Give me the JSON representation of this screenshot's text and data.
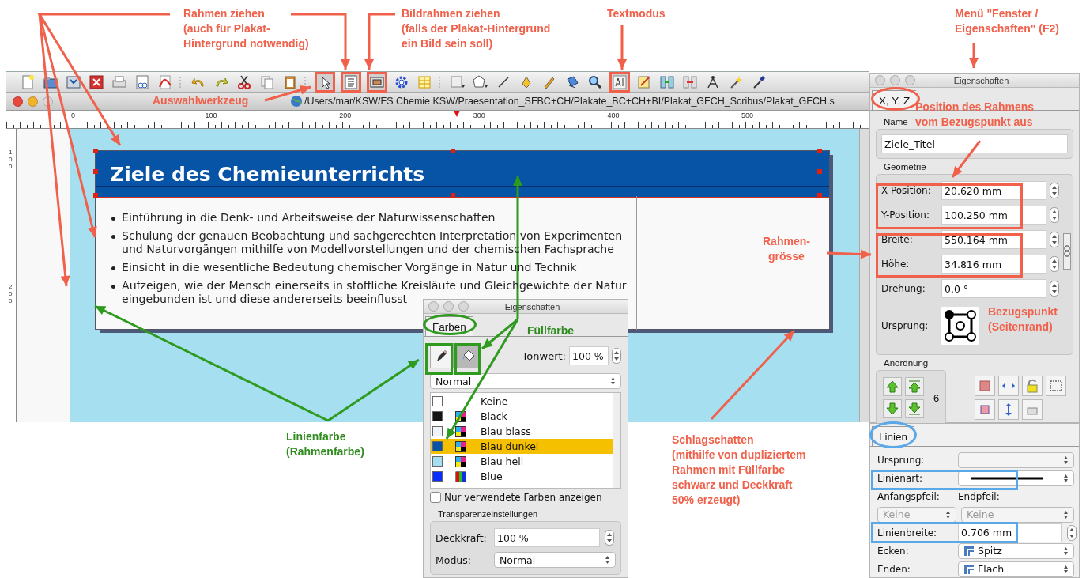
{
  "annotations": [
    {
      "lines": [
        "Rahmen ziehen",
        "(auch für Plakat-",
        "Hintergrund notwendig)"
      ],
      "color": "#f0604a"
    },
    {
      "lines": [
        "Bildrahmen ziehen",
        "(falls der Plakat-Hintergrund",
        "ein Bild sein soll)"
      ],
      "color": "#f0604a"
    },
    {
      "lines": [
        "Textmodus"
      ],
      "color": "#f0604a"
    },
    {
      "lines": [
        "Menü \"Fenster /",
        "Eigenschaften\" (F2)"
      ],
      "color": "#f0604a"
    },
    {
      "lines": [
        "Auswahlwerkzeug"
      ],
      "color": "#f0604a"
    },
    {
      "lines": [
        "Position des Rahmens",
        "vom Bezugspunkt aus"
      ],
      "color": "#f0604a"
    },
    {
      "lines": [
        "Rahmen-",
        "grösse"
      ],
      "color": "#f0604a"
    },
    {
      "lines": [
        "Bezugspunkt",
        "(Seitenrand)"
      ],
      "color": "#f0604a"
    },
    {
      "lines": [
        "Schlagschatten",
        "(mithilfe von dupliziertem",
        "Rahmen mit Füllfarbe",
        "schwarz und Deckkraft",
        "50% erzeugt)"
      ],
      "color": "#f0604a"
    },
    {
      "lines": [
        "Füllfarbe"
      ],
      "color": "#2e8b1e"
    },
    {
      "lines": [
        "Linienfarbe",
        "(Rahmenfarbe)"
      ],
      "color": "#2e8b1e"
    }
  ],
  "document_window": {
    "path": "/Users/mar/KSW/FS Chemie KSW/Praesentation_SFBC+CH/Plakate_BC+CH+BI/Plakat_GFCH_Scribus/Plakat_GFCH.s",
    "ruler": {
      "horizontal": [
        "0",
        "100",
        "200",
        "300",
        "400",
        "500"
      ],
      "vertical": [
        "100",
        "200"
      ]
    },
    "poster": {
      "title": "Ziele des Chemieunterrichts",
      "bullets": [
        "Einführung in die Denk- und Arbeitsweise der Naturwissenschaften",
        "Schulung der genauen Beobachtung und sachgerechten Interpretation von Experimenten und Naturvorgängen mithilfe von Modellvorstellungen und der chemischen Fachsprache",
        "Einsicht in die wesentliche Bedeutung chemischer Vorgänge in Natur und Technik",
        "Aufzeigen, wie der Mensch einerseits in stoffliche Kreisläufe und Gleichgewichte der Natur eingebunden ist und diese andererseits beeinflusst"
      ]
    }
  },
  "properties_panel": {
    "title": "Eigenschaften",
    "tab": "X, Y, Z",
    "name_label": "Name",
    "name_value": "Ziele_Titel",
    "geometry_label": "Geometrie",
    "fields": [
      {
        "label": "X-Position:",
        "value": "20.620 mm"
      },
      {
        "label": "Y-Position:",
        "value": "100.250 mm"
      },
      {
        "label": "Breite:",
        "value": "550.164 mm"
      },
      {
        "label": "Höhe:",
        "value": "34.816 mm"
      },
      {
        "label": "Drehung:",
        "value": "0.0 °"
      }
    ],
    "origin_label": "Ursprung:",
    "arrangement_label": "Anordnung",
    "level_number": "6"
  },
  "lines_panel": {
    "tab": "Linien",
    "rows": [
      {
        "kind": "empty-select",
        "label": "Ursprung:"
      },
      {
        "kind": "line-select",
        "label": "Linienart:"
      },
      {
        "kind": "labels",
        "label": "Anfangspfeil:",
        "label_2": "Endpfeil:"
      },
      {
        "kind": "disabled-selects",
        "value": "Keine",
        "value_2": "Keine"
      },
      {
        "kind": "spin",
        "label": "Linienbreite:",
        "value": "0.706 mm"
      },
      {
        "kind": "icon-select",
        "label": "Ecken:",
        "value": "Spitz"
      },
      {
        "kind": "icon-select",
        "label": "Enden:",
        "value": "Flach"
      }
    ]
  },
  "colors_panel": {
    "title": "Eigenschaften",
    "tab": "Farben",
    "modes": [
      {
        "selected": false
      },
      {
        "selected": true
      }
    ],
    "shade_label": "Tonwert:",
    "shade_value": "100 %",
    "blend_value": "Normal",
    "colors": [
      {
        "name": "Keine",
        "kind": "none",
        "selected": false
      },
      {
        "name": "Black",
        "kind": "cmyk",
        "color": "#141414",
        "selected": false
      },
      {
        "name": "Blau blass",
        "kind": "cmyk",
        "color": "#eef4fa",
        "selected": false
      },
      {
        "name": "Blau dunkel",
        "kind": "cmyk",
        "color": "#0753a5",
        "selected": true
      },
      {
        "name": "Blau hell",
        "kind": "cmyk",
        "color": "#a6dff0",
        "selected": false
      },
      {
        "name": "Blue",
        "kind": "rgb",
        "color": "#0a2cff",
        "selected": false
      }
    ],
    "used_only": {
      "label": "Nur verwendete Farben anzeigen",
      "checked": false
    },
    "transparency_label": "Transparenzeinstellungen",
    "opacity_label": "Deckkraft:",
    "opacity_value": "100 %",
    "mode_label": "Modus:",
    "mode_value": "Normal"
  }
}
